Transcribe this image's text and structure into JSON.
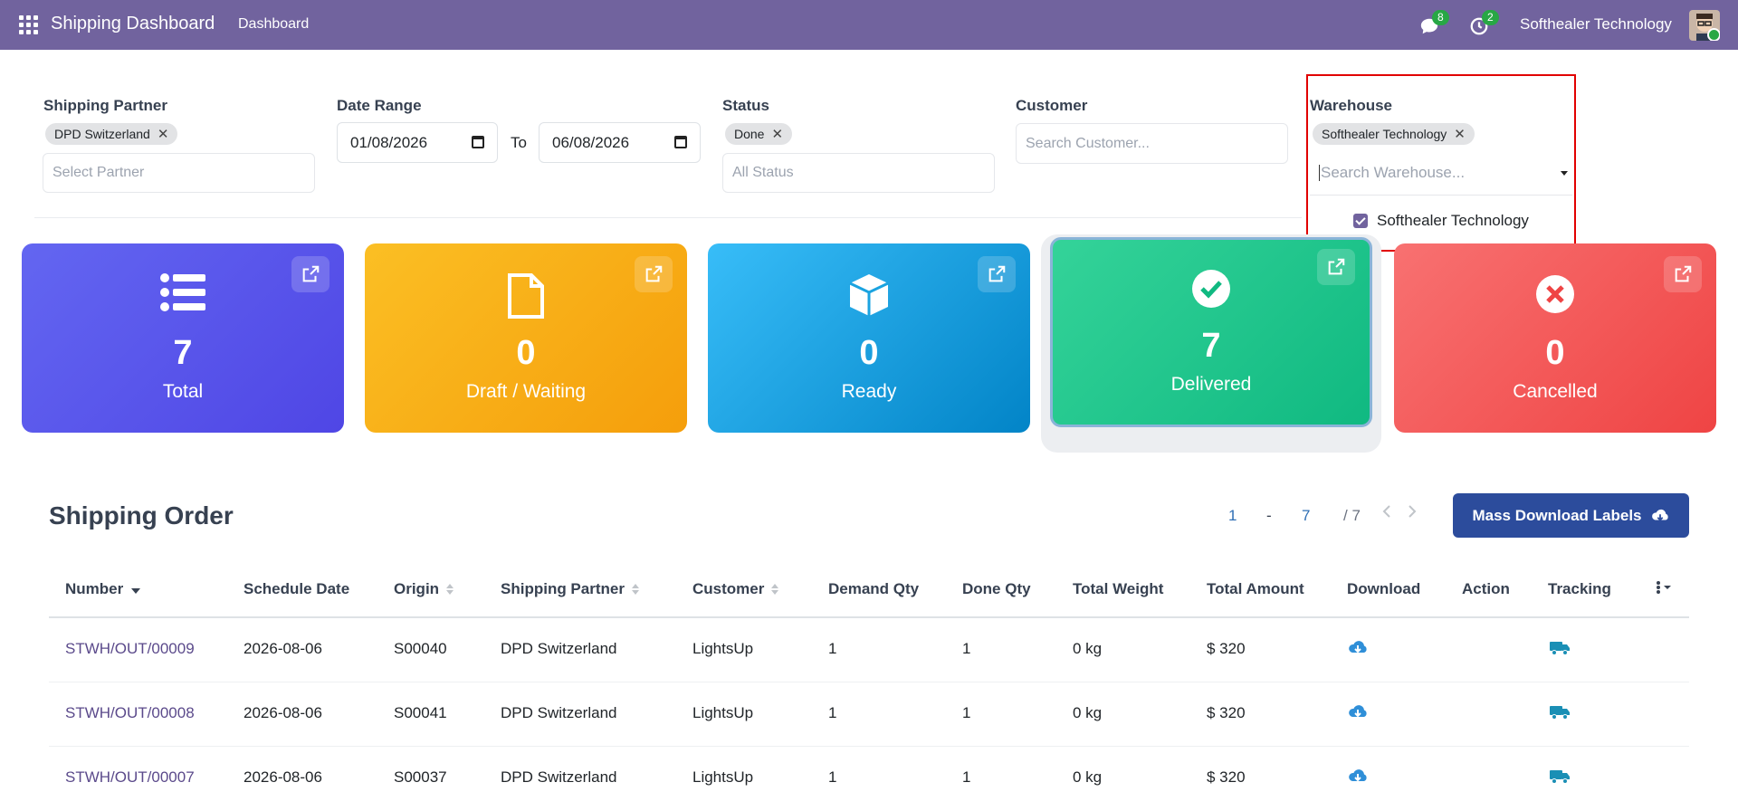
{
  "topbar": {
    "app_title": "Shipping Dashboard",
    "nav_item": "Dashboard",
    "messages_count": "8",
    "activities_count": "2",
    "company": "Softhealer Technology",
    "bg_color": "#71639e"
  },
  "filters": {
    "shipping_partner": {
      "label": "Shipping Partner",
      "tag": "DPD Switzerland",
      "placeholder": "Select Partner"
    },
    "date_range": {
      "label": "Date Range",
      "from": "01/08/2026",
      "to_label": "To",
      "to": "06/08/2026"
    },
    "status": {
      "label": "Status",
      "tag": "Done",
      "placeholder": "All Status"
    },
    "customer": {
      "label": "Customer",
      "placeholder": "Search Customer..."
    },
    "warehouse": {
      "label": "Warehouse",
      "tag": "Softhealer Technology",
      "placeholder": "Search Warehouse...",
      "option": "Softhealer Technology",
      "option_checked": true
    }
  },
  "cards": [
    {
      "count": "7",
      "label": "Total",
      "icon": "list-icon",
      "color": "#4f46e5"
    },
    {
      "count": "0",
      "label": "Draft / Waiting",
      "icon": "file-icon",
      "color": "#f59e0b"
    },
    {
      "count": "0",
      "label": "Ready",
      "icon": "box-icon",
      "color": "#0ea5e9"
    },
    {
      "count": "7",
      "label": "Delivered",
      "icon": "check-circle-icon",
      "color": "#10b981"
    },
    {
      "count": "0",
      "label": "Cancelled",
      "icon": "times-circle-icon",
      "color": "#ef4444"
    }
  ],
  "orders": {
    "title": "Shipping Order",
    "pager": {
      "start": "1",
      "dash": "-",
      "end": "7",
      "total": "/ 7"
    },
    "mass_download_label": "Mass Download Labels",
    "columns": [
      "Number",
      "Schedule Date",
      "Origin",
      "Shipping Partner",
      "Customer",
      "Demand Qty",
      "Done Qty",
      "Total Weight",
      "Total Amount",
      "Download",
      "Action",
      "Tracking"
    ],
    "rows": [
      {
        "number": "STWH/OUT/00009",
        "date": "2026-08-06",
        "origin": "S00040",
        "partner": "DPD Switzerland",
        "customer": "LightsUp",
        "demand": "1",
        "done": "1",
        "weight": "0 kg",
        "amount": "$ 320"
      },
      {
        "number": "STWH/OUT/00008",
        "date": "2026-08-06",
        "origin": "S00041",
        "partner": "DPD Switzerland",
        "customer": "LightsUp",
        "demand": "1",
        "done": "1",
        "weight": "0 kg",
        "amount": "$ 320"
      },
      {
        "number": "STWH/OUT/00007",
        "date": "2026-08-06",
        "origin": "S00037",
        "partner": "DPD Switzerland",
        "customer": "LightsUp",
        "demand": "1",
        "done": "1",
        "weight": "0 kg",
        "amount": "$ 320"
      }
    ]
  }
}
